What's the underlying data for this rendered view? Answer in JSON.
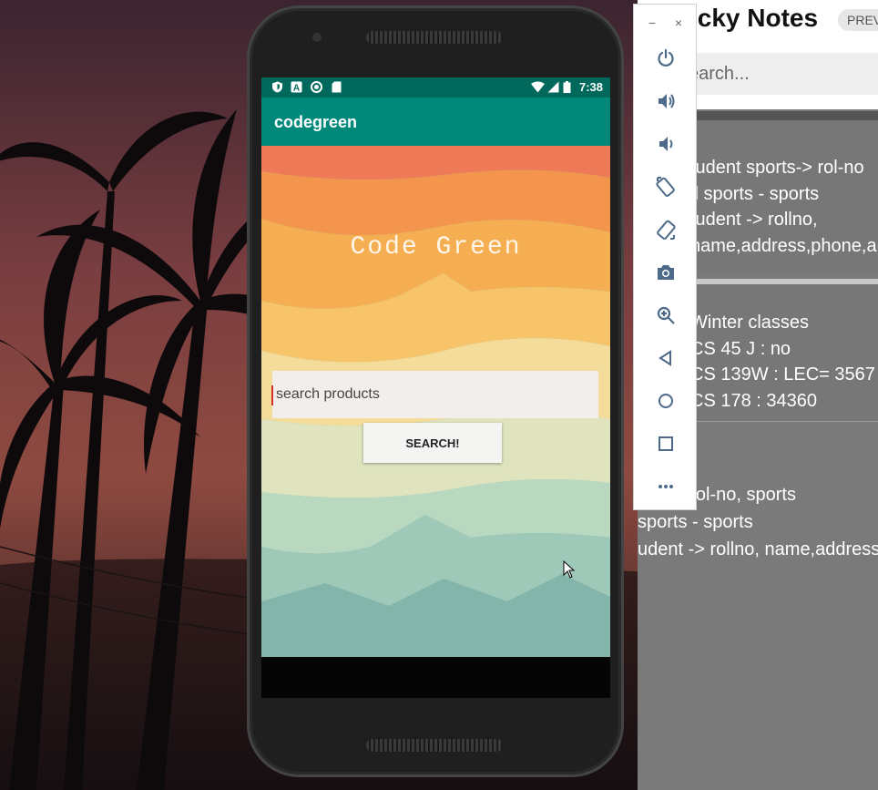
{
  "sticky_notes": {
    "title": "icky Notes",
    "badge": "PREV",
    "search_placeholder": "earch...",
    "notes": [
      {
        "lines": [
          "tudent sports-> rol-no",
          "ll sports - sports",
          "tudent -> rollno,",
          "name,address,phone,a"
        ]
      },
      {
        "lines": [
          "Winter classes",
          "CS 45 J : no",
          "CS 139W : LEC= 3567",
          "CS 178 : 34360"
        ]
      },
      {
        "lines": [
          "orts-> rol-no, sports",
          "sports - sports",
          "udent -> rollno, name,address,"
        ]
      }
    ]
  },
  "emulator_toolbar": {
    "minimize_label": "−",
    "close_label": "×",
    "buttons": [
      {
        "icon": "power-icon"
      },
      {
        "icon": "volume-up-icon"
      },
      {
        "icon": "volume-down-icon"
      },
      {
        "icon": "rotate-left-icon"
      },
      {
        "icon": "rotate-right-icon"
      },
      {
        "icon": "camera-icon"
      },
      {
        "icon": "zoom-icon"
      },
      {
        "icon": "back-icon"
      },
      {
        "icon": "home-icon"
      },
      {
        "icon": "overview-icon"
      },
      {
        "icon": "more-icon"
      }
    ]
  },
  "phone": {
    "status_bar": {
      "time": "7:38"
    },
    "app_bar": {
      "title": "codegreen"
    },
    "banner": {
      "title": "Code Green"
    },
    "search": {
      "placeholder": "search products"
    },
    "search_button": {
      "label": "SEARCH!"
    }
  },
  "colors": {
    "status_bar": "#00695c",
    "app_bar": "#00897b",
    "cursor": "#d32f2f"
  }
}
